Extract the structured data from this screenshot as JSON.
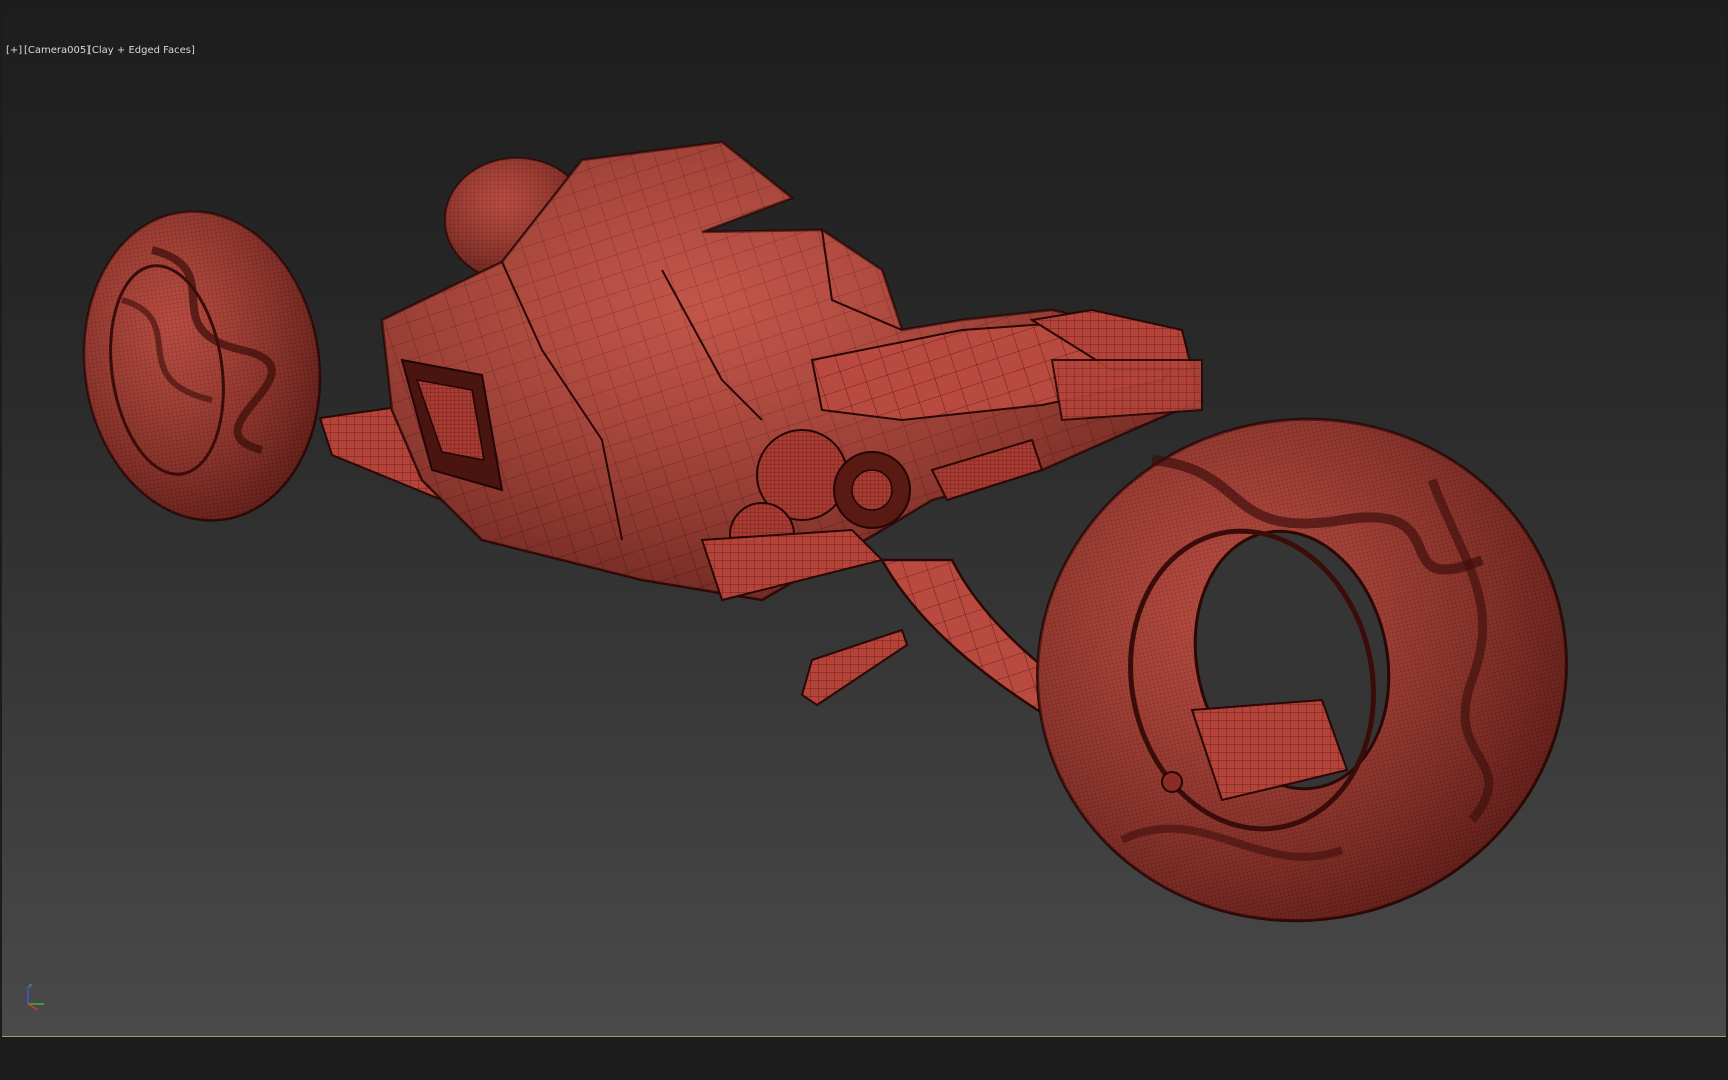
{
  "viewport": {
    "menu_label": "[+]",
    "camera_label": "[Camera005]",
    "shading_label": "[Clay + Edged Faces]"
  },
  "scene": {
    "object": "futuristic-motorcycle-mesh",
    "mesh_color": "#b4443a",
    "wire_color": "#3a0f0c"
  },
  "axis_gizmo": {
    "z_label": "z",
    "x_color": "#d03a3a",
    "y_color": "#3ab43a",
    "z_color": "#3a5ad0"
  }
}
